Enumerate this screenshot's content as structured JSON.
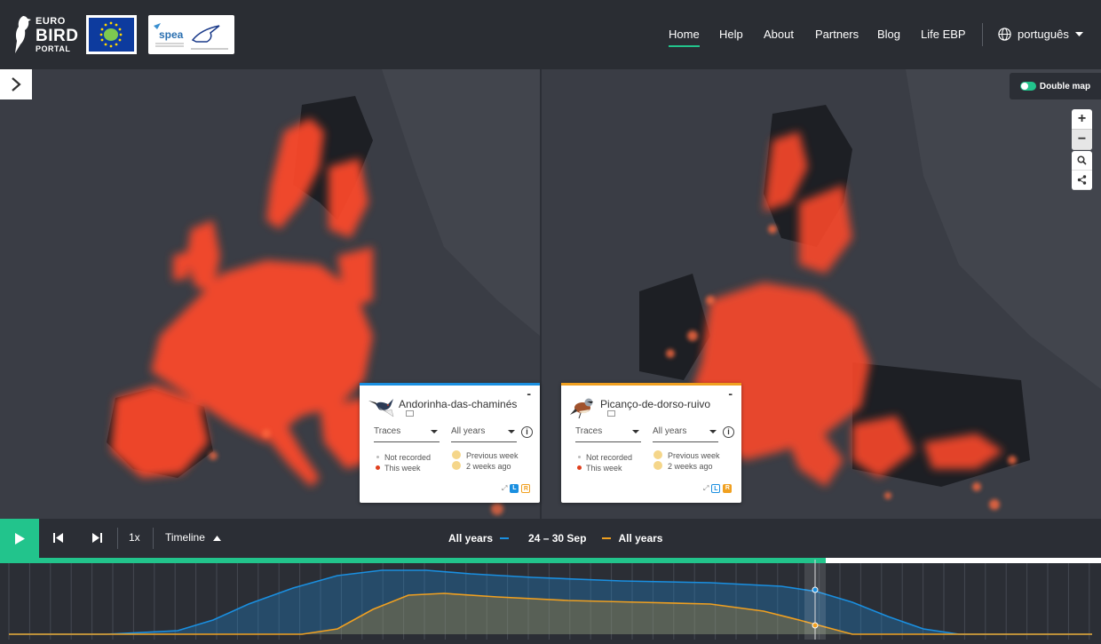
{
  "header": {
    "logo": {
      "line1": "EURO",
      "line2": "BIRD",
      "line3": "PORTAL"
    },
    "partner_logos": [
      "life-logo",
      "spea-logo"
    ],
    "spea_text": "spea",
    "nav": [
      {
        "label": "Home",
        "active": true
      },
      {
        "label": "Help",
        "active": false
      },
      {
        "label": "About",
        "active": false
      },
      {
        "label": "Partners",
        "active": false
      },
      {
        "label": "Blog",
        "active": false
      },
      {
        "label": "Life EBP",
        "active": false
      }
    ],
    "language": "português"
  },
  "map": {
    "double_map_label": "Double map",
    "double_map_enabled": true,
    "zoom_in": "+",
    "zoom_out": "−"
  },
  "cards": [
    {
      "accent": "#1a8fe0",
      "name": "Andorinha-das-chaminés",
      "layer": "Traces",
      "years": "All years",
      "legend": {
        "not_recorded": "Not recorded",
        "this_week": "This week",
        "previous_week": "Previous week",
        "two_weeks_ago": "2 weeks ago"
      },
      "minimize": "-"
    },
    {
      "accent": "#f0a020",
      "name": "Picanço-de-dorso-ruivo",
      "layer": "Traces",
      "years": "All years",
      "legend": {
        "not_recorded": "Not recorded",
        "this_week": "This week",
        "previous_week": "Previous week",
        "two_weeks_ago": "2 weeks ago"
      },
      "minimize": "-"
    }
  ],
  "player": {
    "speed": "1x",
    "timeline_label": "Timeline",
    "left_series": "All years",
    "current_week": "24 – 30 Sep",
    "right_series": "All years"
  },
  "colors": {
    "accent_green": "#22c48c",
    "series_blue": "#1a8fe0",
    "series_orange": "#f0a020",
    "heat": "#ff4a2a"
  }
}
